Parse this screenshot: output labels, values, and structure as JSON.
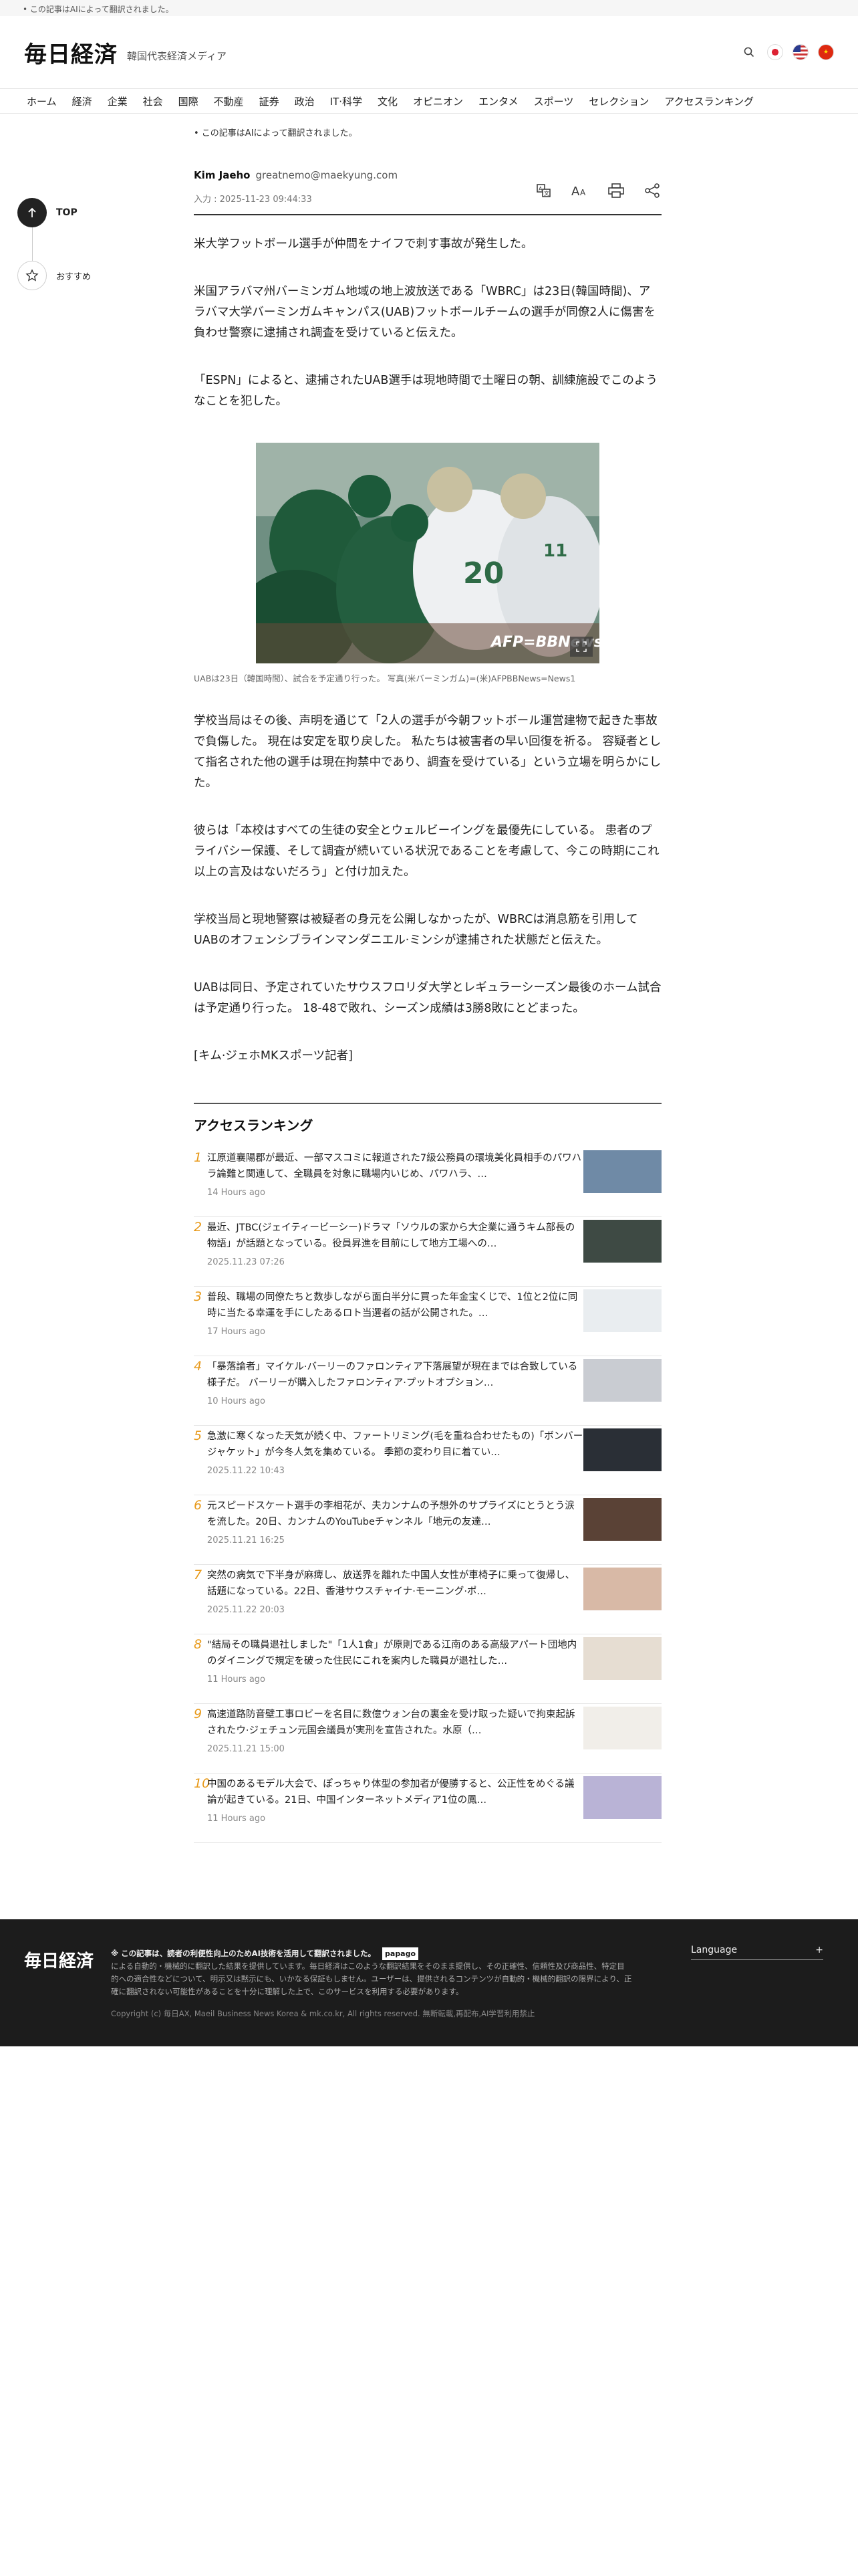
{
  "top_notice": "• この記事はAIによって翻訳されました。",
  "header": {
    "logo": "毎日経済",
    "subtitle": "韓国代表経済メディア"
  },
  "nav": [
    "ホーム",
    "経済",
    "企業",
    "社会",
    "国際",
    "不動産",
    "証券",
    "政治",
    "IT·科学",
    "文化",
    "オピニオン",
    "エンタメ",
    "スポーツ",
    "セレクション",
    "アクセスランキング"
  ],
  "sidebar": {
    "top_label": "TOP",
    "recommend_label": "おすすめ"
  },
  "article": {
    "ai_notice": "• この記事はAIによって翻訳されました。",
    "author": "Kim Jaeho",
    "email": "greatnemo@maekyung.com",
    "date": "入力 : 2025-11-23 09:44:33",
    "paragraphs": [
      "米大学フットボール選手が仲間をナイフで刺す事故が発生した。",
      "米国アラバマ州バーミンガム地域の地上波放送である「WBRC」は23日(韓国時間)、アラバマ大学バーミンガムキャンパス(UAB)フットボールチームの選手が同僚2人に傷害を負わせ警察に逮捕され調査を受けていると伝えた。",
      "「ESPN」によると、逮捕されたUAB選手は現地時間で土曜日の朝、訓練施設でこのようなことを犯した。"
    ],
    "photo_watermark": "AFP=BBNews",
    "caption": "UABは23日（韓国時間）、試合を予定通り行った。 写真(米バーミンガム)=(米)AFPBBNews=News1",
    "paragraphs2": [
      "学校当局はその後、声明を通じて「2人の選手が今朝フットボール運営建物で起きた事故で負傷した。 現在は安定を取り戻した。 私たちは被害者の早い回復を祈る。 容疑者として指名された他の選手は現在拘禁中であり、調査を受けている」という立場を明らかにした。",
      "彼らは「本校はすべての生徒の安全とウェルビーイングを最優先にしている。 患者のプライバシー保護、そして調査が続いている状況であることを考慮して、今この時期にこれ以上の言及はないだろう」と付け加えた。",
      "学校当局と現地警察は被疑者の身元を公開しなかったが、WBRCは消息筋を引用してUABのオフェンシブラインマンダニエル·ミンシが逮捕された状態だと伝えた。",
      "UABは同日、予定されていたサウスフロリダ大学とレギュラーシーズン最後のホーム試合は予定通り行った。 18-48で敗れ、シーズン成績は3勝8敗にとどまった。",
      "[キム·ジェホMKスポーツ記者]"
    ]
  },
  "ranking": {
    "title": "アクセスランキング",
    "items": [
      {
        "num": "1",
        "text": "江原道襄陽郡が最近、一部マスコミに報道された7級公務員の環境美化員相手のパワハラ論難と関連して、全職員を対象に職場内いじめ、パワハラ、…",
        "time": "14 Hours ago",
        "thumb": "#6f8aa6"
      },
      {
        "num": "2",
        "text": "最近、JTBC(ジェイティービーシー)ドラマ「ソウルの家から大企業に通うキム部長の物語」が話題となっている。役員昇進を目前にして地方工場への…",
        "time": "2025.11.23 07:26",
        "thumb": "#3e4a44"
      },
      {
        "num": "3",
        "text": "普段、職場の同僚たちと数歩しながら面白半分に買った年金宝くじで、1位と2位に同時に当たる幸運を手にしたあるロト当選者の話が公開された。…",
        "time": "17 Hours ago",
        "thumb": "#e9edf0"
      },
      {
        "num": "4",
        "text": "「暴落論者」マイケル·バーリーのファロンティア下落展望が現在までは合致している様子だ。 バーリーが購入したファロンティア·プットオプション…",
        "time": "10 Hours ago",
        "thumb": "#c9ccd2"
      },
      {
        "num": "5",
        "text": "急激に寒くなった天気が続く中、ファートリミング(毛を重ね合わせたもの)「ボンバージャケット」が今冬人気を集めている。 季節の変わり目に着てい…",
        "time": "2025.11.22 10:43",
        "thumb": "#2a2f36"
      },
      {
        "num": "6",
        "text": "元スピードスケート選手の李相花が、夫カンナムの予想外のサプライズにとうとう涙を流した。20日、カンナムのYouTubeチャンネル「地元の友達…",
        "time": "2025.11.21 16:25",
        "thumb": "#5a4236"
      },
      {
        "num": "7",
        "text": "突然の病気で下半身が麻痺し、放送界を離れた中国人女性が車椅子に乗って復帰し、話題になっている。22日、香港サウスチャイナ·モーニング·ポ…",
        "time": "2025.11.22 20:03",
        "thumb": "#d8b9a6"
      },
      {
        "num": "8",
        "text": "\"結局その職員退社しました\"「1人1食」が原則である江南のある高級アパート団地内のダイニングで規定を破った住民にこれを案内した職員が退社した…",
        "time": "11 Hours ago",
        "thumb": "#e6ddd2"
      },
      {
        "num": "9",
        "text": "高速道路防音壁工事ロビーを名目に数億ウォン台の裏金を受け取った疑いで拘束起訴されたウ·ジェチュン元国会議員が実刑を宣告された。水原（…",
        "time": "2025.11.21 15:00",
        "thumb": "#f1eee9"
      },
      {
        "num": "10",
        "text": "中国のあるモデル大会で、ぽっちゃり体型の参加者が優勝すると、公正性をめぐる議論が起きている。21日、中国インターネットメディア1位の鳳…",
        "time": "11 Hours ago",
        "thumb": "#b9b3d6"
      }
    ]
  },
  "footer": {
    "logo": "毎日経済",
    "ai_note": "※ この記事は、読者の利便性向上のためAI技術を活用して翻訳されました。",
    "papago": "papago",
    "text": "による自動的・機械的に翻訳した結果を提供しています。毎日経済はこのような翻訳結果をそのまま提供し、その正確性、信頼性及び商品性、特定目的への適合性などについて、明示又は黙示にも、いかなる保証もしません。ユーザーは、提供されるコンテンツが自動的・機械的翻訳の限界により、正確に翻訳されない可能性があることを十分に理解した上で、このサービスを利用する必要があります。",
    "copyright": "Copyright (c) 毎日AX, Maeil Business News Korea & mk.co.kr, All rights reserved. 無断転載,再配布,AI学習利用禁止",
    "language_label": "Language",
    "language_plus": "+"
  },
  "colors": {
    "accent_rank": "#e89a1b",
    "footer_bg": "#1c1c1c"
  },
  "icons": [
    "search-icon",
    "korea-flag-icon",
    "usa-flag-icon",
    "china-flag-icon",
    "arrow-up-icon",
    "star-icon",
    "translate-icon",
    "font-size-icon",
    "print-icon",
    "share-icon",
    "expand-icon"
  ]
}
